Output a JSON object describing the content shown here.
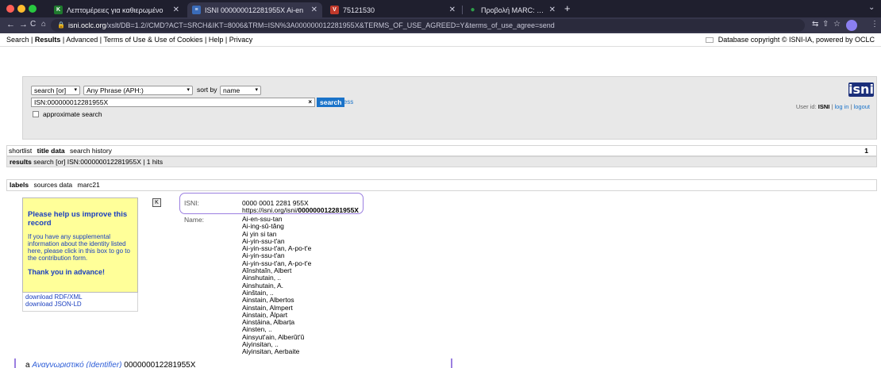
{
  "browser": {
    "tabs": [
      {
        "title": "Λεπτομέρειες για καθιερωμένο",
        "favicon": "K",
        "favicon_color": "#1f7a2e",
        "active": false
      },
      {
        "title": "ISNI 000000012281955X Ai-en",
        "favicon": "≡",
        "favicon_color": "#3a6bb8",
        "active": true
      },
      {
        "title": "75121530",
        "favicon": "V",
        "favicon_color": "#c0392b",
        "active": false
      },
      {
        "title": "Προβολή MARC: Einstein, Albe",
        "favicon": "●",
        "favicon_color": "#2e9e4a",
        "active": false
      }
    ],
    "new_tab": "+",
    "url_host": "isni.oclc.org",
    "url_path": "/xslt/DB=1.2//CMD?ACT=SRCH&IKT=8006&TRM=ISN%3A000000012281955X&TERMS_OF_USE_AGREED=Y&terms_of_use_agree=send"
  },
  "menu": {
    "items": [
      "Search",
      "Results",
      "Advanced",
      "Terms of Use & Use of Cookies",
      "Help",
      "Privacy"
    ],
    "separator": " | ",
    "copyright": "Database copyright © ISNI-IA, powered by OCLC"
  },
  "search": {
    "mode": "search [or]",
    "index": "Any Phrase (APH:)",
    "sort_label": "sort by",
    "sort_value": "name",
    "query": "ISN:000000012281955X",
    "clear": "×",
    "button": "search",
    "less": "less",
    "approximate": "approximate search"
  },
  "logo": "isni",
  "user": {
    "prefix": "User id:",
    "id": "ISNI",
    "login": "log in",
    "logout": "logout",
    "sep": " | "
  },
  "result_tabs": [
    "shortlist",
    "title data",
    "search history"
  ],
  "hit_index": "1",
  "results_bar": {
    "label": "results",
    "text": "search [or]  ISN:000000012281955X  |  1 hits"
  },
  "view_tabs": [
    "labels",
    "sources data",
    "marc21"
  ],
  "help": {
    "title": "Please help us improve this record",
    "body": "If you have any supplemental information about the identity listed here, please click in this box to go to the contribution form.",
    "thanks": "Thank you in advance!"
  },
  "downloads": [
    "download RDF/XML",
    "download JSON-LD"
  ],
  "record": {
    "isni_label": "ISNI:",
    "isni": "0000 0001 2281 955X",
    "isni_url_prefix": "https://isni.org/isni/",
    "isni_url_id": "000000012281955X",
    "name_label": "Name:",
    "names": [
      "Ai-en-ssu-tan",
      "Ai-ing-sŭ-tăng",
      "Ai yin si tan",
      "Ai-yin-ssu-t'an",
      "Ai-yin-ssu-t'an, A-po-t'e",
      "Ai-yin-ssu-t'an",
      "Ai-yin-ssu-t'an, A-po-t'e",
      "Aĭnshtaĭn, Albert",
      "Ainshutain, ..",
      "Ainshutain, A.",
      "Ainštain, ..",
      "Ainstain, Albertos",
      "Ainstain, Almpert",
      "Ainstaiṇ, Ālpart",
      "Ainsṭāina, Albarṭa",
      "Ainsten, ..",
      "Ainsyut'ain, Alberŭt'ŭ",
      "Aiyinsitan, ..",
      "Aiyinsitan, Aerbaite"
    ]
  },
  "bottom": {
    "prefix": "a",
    "label": "Αναγνωριστικό (Identifier)",
    "value": "000000012281955X"
  }
}
